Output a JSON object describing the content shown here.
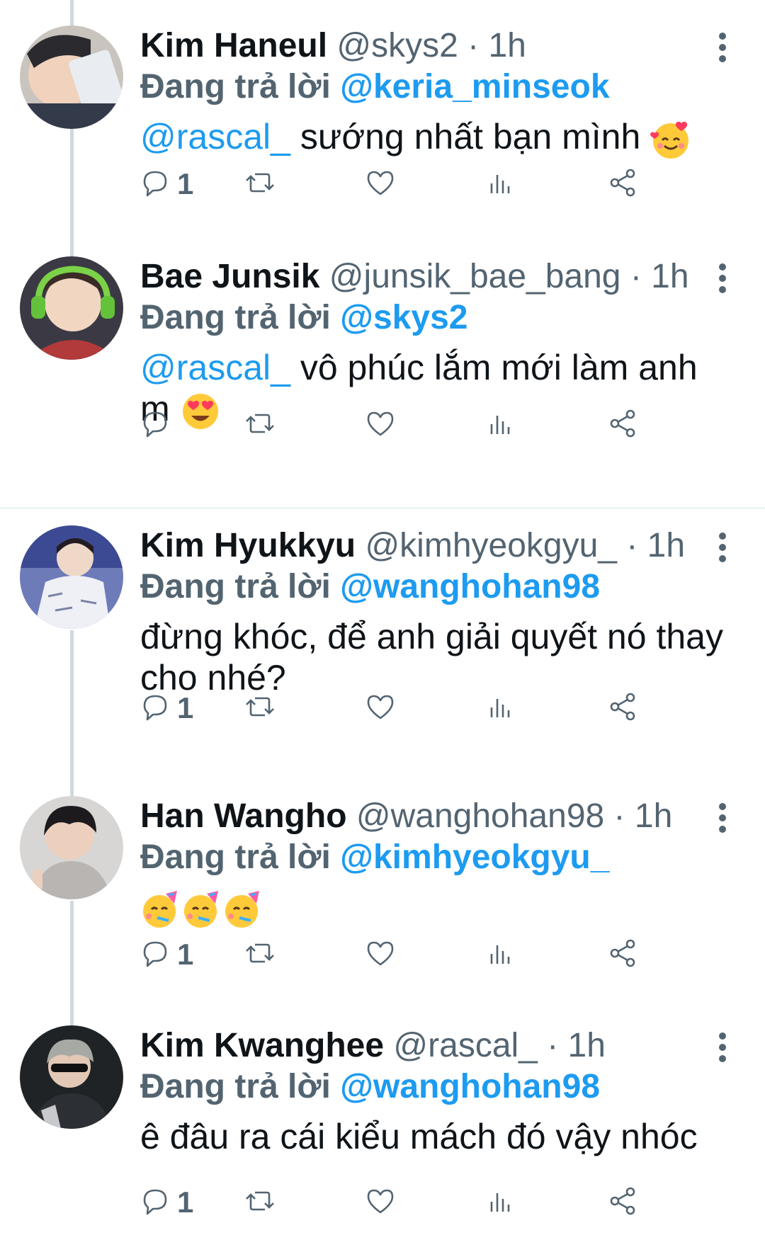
{
  "colors": {
    "accent": "#1d9bf0",
    "secondary_text": "#536471",
    "thread_line": "#cfd9de"
  },
  "icons": {
    "reply": "reply-icon",
    "retweet": "retweet-icon",
    "like": "heart-icon",
    "views": "views-chart-icon",
    "share": "share-icon",
    "more": "more-options-icon"
  },
  "tweets": [
    {
      "name": "Kim Haneul",
      "handle": "@skys2",
      "time": "· 1h",
      "reply_prefix": "Đang trả lời",
      "reply_to": "@keria_minseok",
      "mention": "@rascal_",
      "text": " sướng nhất bạn mình ",
      "emoji": "smiling-face-with-hearts",
      "reply_count": "1"
    },
    {
      "name": "Bae Junsik",
      "handle": "@junsik_bae_bang",
      "time": "· 1h",
      "reply_prefix": "Đang trả lời",
      "reply_to": "@skys2",
      "mention": "@rascal_",
      "text": " vô phúc lắm mới làm anh m ",
      "emoji": "heart-eyes",
      "reply_count": ""
    },
    {
      "name": "Kim Hyukkyu",
      "handle": "@kimhyeokgyu_",
      "time": "· 1h",
      "reply_prefix": "Đang trả lời",
      "reply_to": "@wanghohan98",
      "mention": "",
      "text": "đừng khóc, để anh giải quyết nó thay cho nhé?",
      "emoji": "",
      "reply_count": "1"
    },
    {
      "name": "Han Wangho",
      "handle": "@wanghohan98",
      "time": "· 1h",
      "reply_prefix": "Đang trả lời",
      "reply_to": "@kimhyeokgyu_",
      "mention": "",
      "text": "",
      "emoji": "partying-face x3",
      "reply_count": "1"
    },
    {
      "name": "Kim Kwanghee",
      "handle": "@rascal_",
      "time": "· 1h",
      "reply_prefix": "Đang trả lời",
      "reply_to": "@wanghohan98",
      "mention": "",
      "text": "ê đâu ra cái kiểu mách đó vậy nhóc",
      "emoji": "",
      "reply_count": "1"
    }
  ]
}
